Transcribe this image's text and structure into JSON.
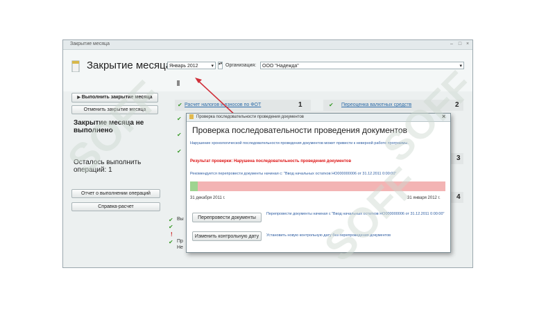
{
  "window": {
    "title": "Закрытие месяца"
  },
  "header": {
    "title": "Закрытие месяца",
    "period_value": "Январь 2012",
    "org_label": "Организация:",
    "org_value": "ООО \"Надежда\""
  },
  "left_panel": {
    "run_button": "Выполнить закрытие месяца",
    "cancel_button": "Отменить закрытие месяца",
    "status": "Закрытие месяца не выполнено",
    "remaining": "Осталось выполнить операций: 1",
    "report_button": "Отчет о выполнении операций",
    "help_button": "Справка-расчет"
  },
  "operations": [
    {
      "label": "Расчет налогов и взносов по ФОТ",
      "number": "1"
    },
    {
      "label": "Переоценка валютных средств",
      "number": "2"
    }
  ],
  "side_numbers": [
    "3",
    "4"
  ],
  "dialog": {
    "window_title": "Проверка последовательности проведения документов",
    "title": "Проверка последовательности проведения документов",
    "description": "Нарушение хронологической последовательности проведения документов может привести к неверной работе программы.",
    "result": "Результат проверки: Нарушена последовательность проведения документов",
    "recommend": "Рекомендуется перепровести документы начиная с: \"Ввод начальных остатков НО000000006 от 31.12.2011 0:00:00\"",
    "progress": 0.03,
    "date_start": "31 декабря 2011 г.",
    "date_end": "31 января 2012 г.",
    "repost_button": "Перепровести документы",
    "repost_desc": "Перепровести документы начиная с \"Ввод начальных остатков НО000000006 от 31.12.2011 0:00:00\"",
    "change_button": "Изменить контрольную дату",
    "change_desc": "Установить новую контрольную дату без перепроведения документов"
  },
  "bottom_lines": [
    "Вы",
    "Пр",
    "Не"
  ],
  "watermark": "SOFF",
  "colors": {
    "accent": "#2a6aa8",
    "error": "#d11111",
    "progress_bad": "#f3b4b4",
    "progress_good": "#9ed490",
    "arrow": "#d0303a"
  }
}
